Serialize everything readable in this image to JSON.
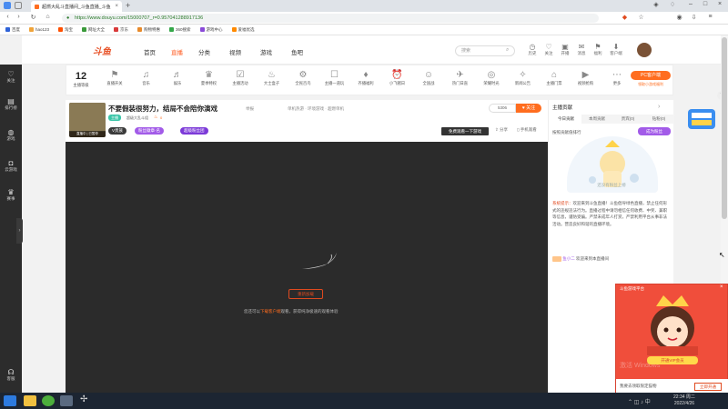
{
  "browser": {
    "tab_title": "超燃大乱斗直播间_斗鱼直播_斗鱼",
    "url": "https://www.douyu.com/15000707_r=0.9570412889171​36",
    "bookmarks": [
      "百度",
      "hao123",
      "淘宝",
      "网址大全",
      "京东",
      "购物特惠",
      "360搜索",
      "游戏中心",
      "爱福优选"
    ]
  },
  "rail": {
    "items": [
      "关注",
      "排行榜",
      "游戏",
      "云游戏",
      "赛事",
      "客服"
    ]
  },
  "header": {
    "logo": "斗鱼",
    "nav": [
      "首页",
      "直播",
      "分类",
      "视频",
      "游戏",
      "鱼吧"
    ],
    "search_placeholder": "搜索",
    "icons": [
      "历史",
      "关注",
      "开播",
      "消息",
      "福利",
      "客户端"
    ]
  },
  "catbar": {
    "level_num": "12",
    "level_label": "主播等级",
    "items": [
      "直播开关",
      "音乐",
      "娱乐",
      "夏季特权",
      "主播活动",
      "大士盒子",
      "全民百鸟",
      "主播一道玩",
      "齐播福利",
      "小飞猪日",
      "全国战",
      "热门日直",
      "荣耀时光",
      "新闻公告",
      "主播门票",
      "视频抢购",
      "更多"
    ],
    "pc_client": "PC客户端",
    "pc_client_sub": "领取小游戏福利"
  },
  "room": {
    "thumb_caption": "直播中 | 已暂停",
    "title": "不要假装很努力，结局不会陪你演戏",
    "report": "举报",
    "tags": "单机热游 · 环境游戏 · 超燃单机",
    "tag_a": "主播",
    "tag_b": "超级大乱斗组",
    "tag_c": "0",
    "pill_vip": "V贵族",
    "pill_fans": "粉丝徽章·名",
    "pill_hot": "超级粉丝团",
    "follow_count": "5306",
    "follow_label": "关注",
    "shot_label": "免费观看一下游戏",
    "share_label": "分享",
    "mobile_label": "手机观看"
  },
  "player": {
    "error_button": "重新加载",
    "tip_before": "您还可以",
    "tip_link": "下载客户端",
    "tip_after": "观看，获得纯净极速的观看体验"
  },
  "right": {
    "title": "主播贡献",
    "tabs": [
      "今日贡献",
      "本周贡献",
      "贵宾(0)",
      "钻粉(0)"
    ],
    "sub": "按照贡献值排行",
    "badge": "成为粉丝",
    "empty": "还没有粉丝上榜",
    "sys_label": "系统提示：",
    "sys_text": "欢迎来到斗鱼直播！斗鱼倡导绿色直播，禁止任何形式的违规违法行为。直播过程中请勿相信任何收费、中奖、兼职等信息，谨防受骗。严禁未成年人打赏，严禁利用平台从事非法活动。营造良好和谐的直播环境。",
    "welcome_user": "鱼小二",
    "welcome_text": "欢迎来到本直播间"
  },
  "popup": {
    "title": "斗鱼游戏平台",
    "vip": "开通VIP会员",
    "watermark": "激活 Windows",
    "bottom": "我要去领取限定猫物",
    "button": "立即开通"
  },
  "taskbar": {
    "time": "22:34 周二",
    "date": "2022/4/26"
  }
}
